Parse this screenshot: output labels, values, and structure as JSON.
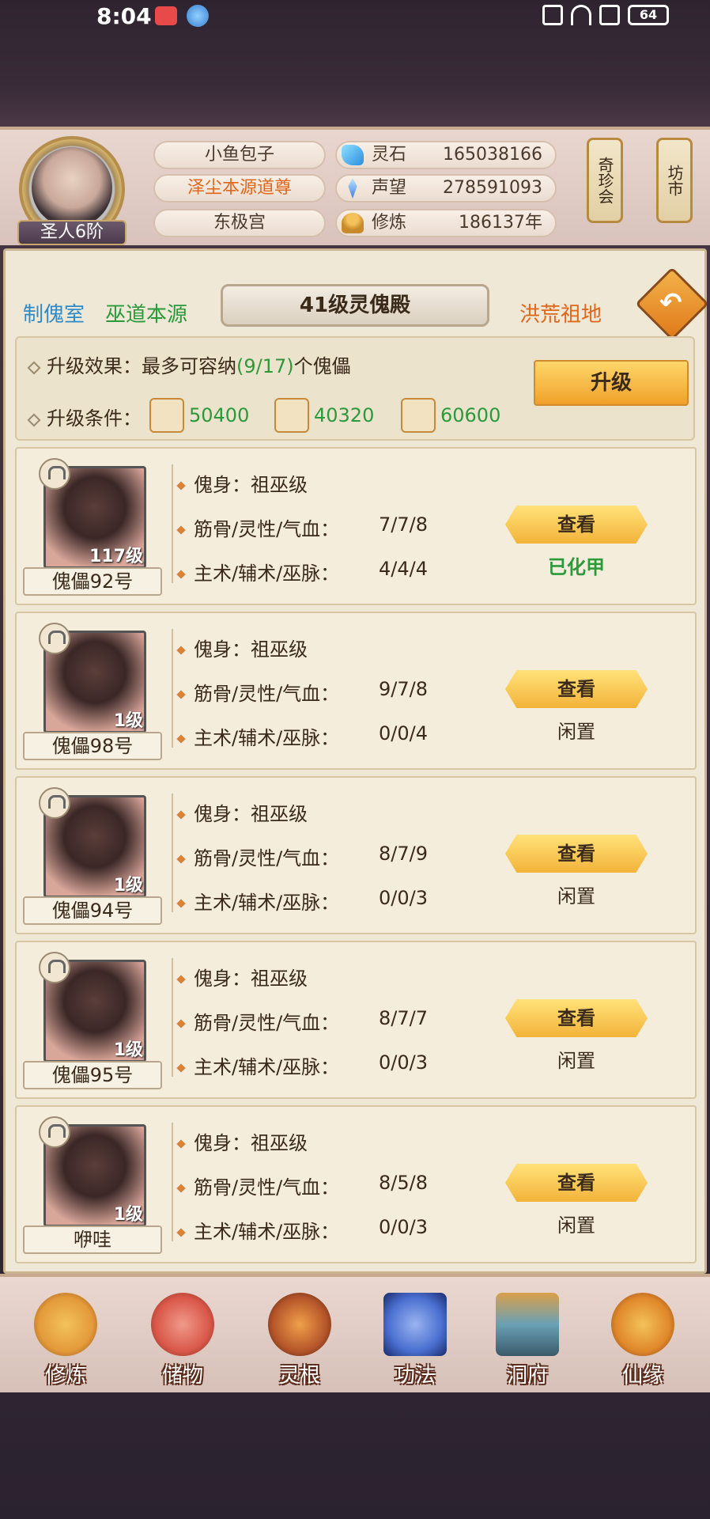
{
  "status_bar": {
    "time": "8:04",
    "battery": "64"
  },
  "player": {
    "rank": "圣人6阶",
    "name": "小鱼包子",
    "title": "泽尘本源道尊",
    "sect": "东极宫",
    "stats": [
      {
        "label": "灵石",
        "value": "165038166",
        "icon": "spirit-stone-icon"
      },
      {
        "label": "声望",
        "value": "278591093",
        "icon": "fame-icon"
      },
      {
        "label": "修炼",
        "value": "186137年",
        "icon": "cultivation-icon"
      }
    ]
  },
  "side_buttons": [
    "奇珍会",
    "坊市"
  ],
  "nav": {
    "left1": "制傀室",
    "left2": "巫道本源",
    "title": "41级灵傀殿",
    "right": "洪荒祖地"
  },
  "upgrade": {
    "effect_label": "升级效果：",
    "effect_text_pre": "最多可容纳",
    "effect_highlight": "(9/17)",
    "effect_text_post": "个傀儡",
    "condition_label": "升级条件：",
    "materials": [
      "50400",
      "40320",
      "60600"
    ],
    "button": "升级"
  },
  "puppets": [
    {
      "name": "傀儡92号",
      "level": "117级",
      "body": "傀身：祖巫级",
      "stats_label": "筋骨/灵性/气血：",
      "stats": "7/7/8",
      "skills_label": "主术/辅术/巫脉：",
      "skills": "4/4/4",
      "button": "查看",
      "status": "已化甲"
    },
    {
      "name": "傀儡98号",
      "level": "1级",
      "body": "傀身：祖巫级",
      "stats_label": "筋骨/灵性/气血：",
      "stats": "9/7/8",
      "skills_label": "主术/辅术/巫脉：",
      "skills": "0/0/4",
      "button": "查看",
      "status": "闲置"
    },
    {
      "name": "傀儡94号",
      "level": "1级",
      "body": "傀身：祖巫级",
      "stats_label": "筋骨/灵性/气血：",
      "stats": "8/7/9",
      "skills_label": "主术/辅术/巫脉：",
      "skills": "0/0/3",
      "button": "查看",
      "status": "闲置"
    },
    {
      "name": "傀儡95号",
      "level": "1级",
      "body": "傀身：祖巫级",
      "stats_label": "筋骨/灵性/气血：",
      "stats": "8/7/7",
      "skills_label": "主术/辅术/巫脉：",
      "skills": "0/0/3",
      "button": "查看",
      "status": "闲置"
    },
    {
      "name": "咿哇",
      "level": "1级",
      "body": "傀身：祖巫级",
      "stats_label": "筋骨/灵性/气血：",
      "stats": "8/5/8",
      "skills_label": "主术/辅术/巫脉：",
      "skills": "0/0/3",
      "button": "查看",
      "status": "闲置"
    }
  ],
  "bottom_nav": [
    {
      "label": "修炼",
      "icon": "cultivate-icon",
      "color": "#e39a3a"
    },
    {
      "label": "储物",
      "icon": "storage-bag-icon",
      "color": "#d9584a"
    },
    {
      "label": "灵根",
      "icon": "spirit-root-icon",
      "color": "#b5552a"
    },
    {
      "label": "功法",
      "icon": "technique-book-icon",
      "color": "#4a6fd0"
    },
    {
      "label": "洞府",
      "icon": "cave-dwelling-icon",
      "color": "#6aa0b5"
    },
    {
      "label": "仙缘",
      "icon": "fate-gourd-icon",
      "color": "#e0882a"
    }
  ]
}
